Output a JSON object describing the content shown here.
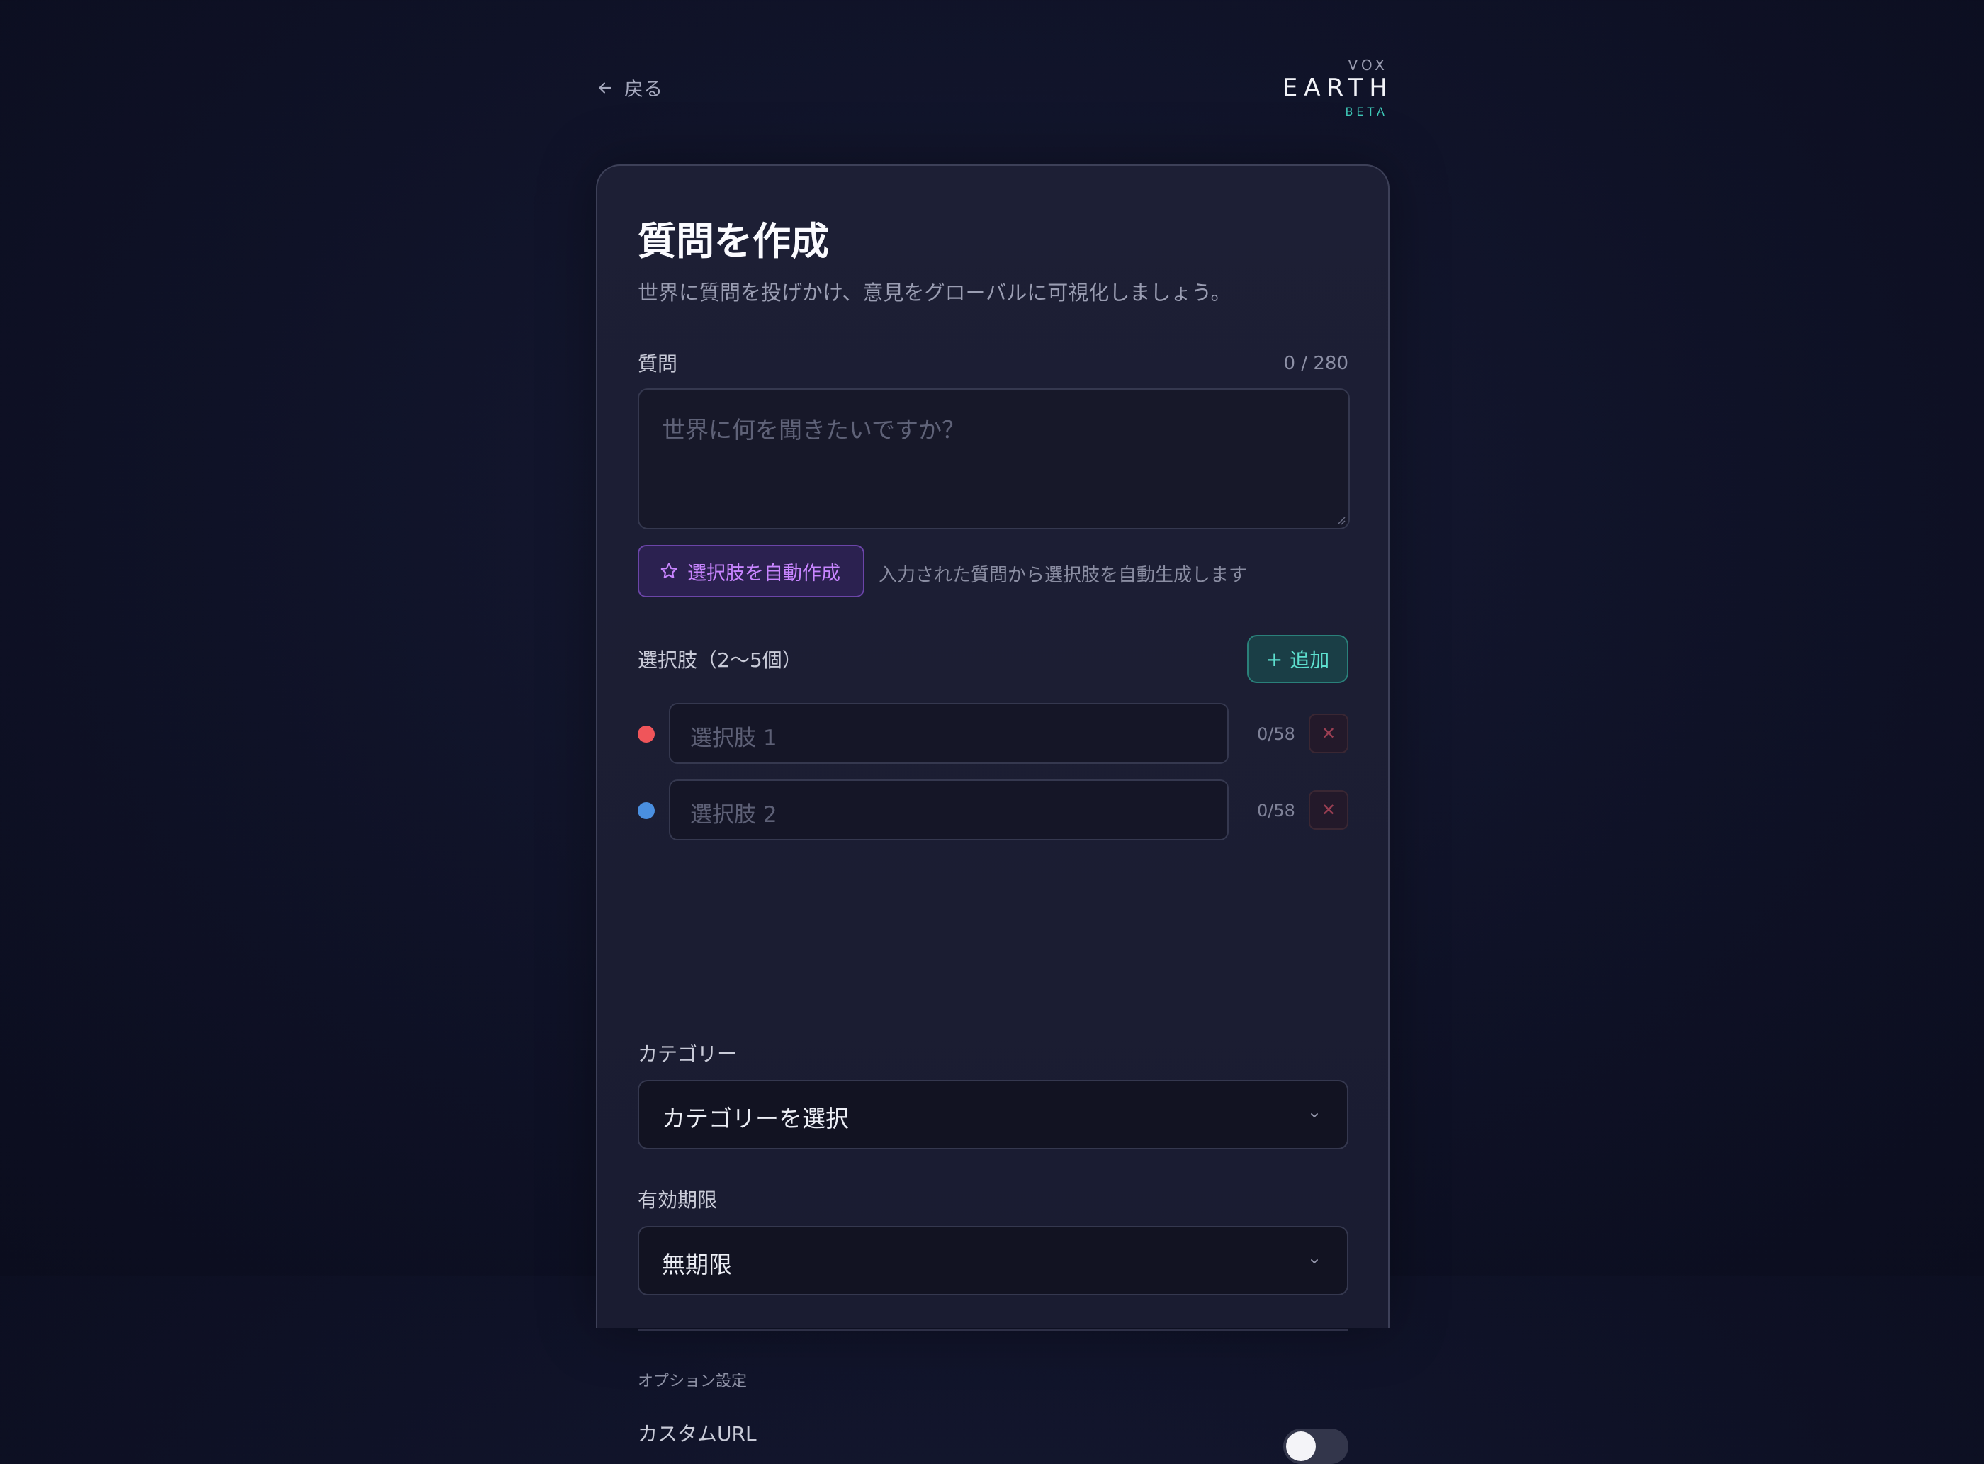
{
  "nav": {
    "back_label": "戻る"
  },
  "logo": {
    "top": "VOX",
    "main": "EARTH",
    "badge": "BETA"
  },
  "form": {
    "title": "質問を作成",
    "subtitle": "世界に質問を投げかけ、意見をグローバルに可視化しましょう。",
    "question": {
      "label": "質問",
      "counter": "0 / 280",
      "placeholder": "世界に何を聞きたいですか？",
      "value": ""
    },
    "auto_generate": {
      "button_label": "選択肢を自動作成",
      "hint": "入力された質問から選択肢を自動生成します"
    },
    "options": {
      "label": "選択肢（2〜5個）",
      "add_label": "追加",
      "items": [
        {
          "placeholder": "選択肢 1",
          "value": "",
          "counter": "0/58",
          "color": "#f0555a"
        },
        {
          "placeholder": "選択肢 2",
          "value": "",
          "counter": "0/58",
          "color": "#4a8fe0"
        }
      ]
    },
    "category": {
      "label": "カテゴリー",
      "selected": "カテゴリーを選択"
    },
    "expiry": {
      "label": "有効期限",
      "selected": "無期限"
    },
    "options_section": {
      "title": "オプション設定",
      "custom_url": {
        "label": "カスタムURL",
        "enabled": false
      }
    }
  },
  "colors": {
    "accent_teal": "#3fcab9",
    "accent_purple": "#c885ff",
    "danger": "#9a3e52"
  }
}
